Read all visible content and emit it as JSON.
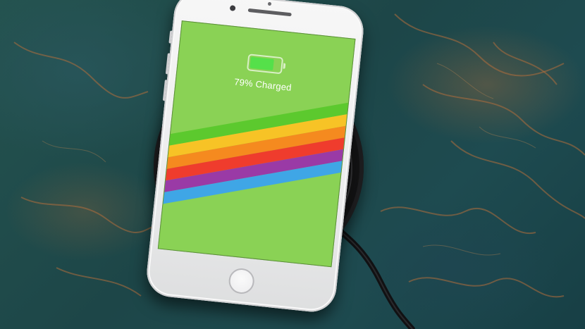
{
  "phone": {
    "charge_label": "79% Charged",
    "battery_level": 0.79,
    "screen_color": "#8ad255",
    "stripe_colors": [
      "#5cc92e",
      "#f7c326",
      "#f58a1f",
      "#ef3c2d",
      "#9a3aa6",
      "#3fa6e6"
    ]
  },
  "scene": {
    "surface_color": "#1f4a4c",
    "vein_color": "#b06e3c",
    "pad_color": "#151516"
  }
}
